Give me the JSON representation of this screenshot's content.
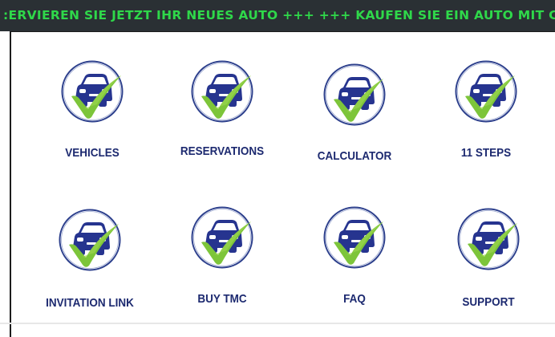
{
  "ticker": {
    "text": ":ERVIEREN SIE JETZT IHR NEUES AUTO +++  +++ KAUFEN SIE EIN AUTO MIT CRYPTO"
  },
  "icon": "car-checkmark-icon",
  "colors": {
    "ticker_background": "#2a3034",
    "ticker_text": "#2fd84a",
    "label": "#1d2a70",
    "car": "#26348f",
    "check": "#7dc53a",
    "ring": "#2c3f8c"
  },
  "tiles": [
    {
      "label": "VEHICLES"
    },
    {
      "label": "RESERVATIONS"
    },
    {
      "label": "CALCULATOR"
    },
    {
      "label": "11 STEPS"
    },
    {
      "label": "INVITATION LINK"
    },
    {
      "label": "BUY TMC"
    },
    {
      "label": "FAQ"
    },
    {
      "label": "SUPPORT"
    }
  ]
}
